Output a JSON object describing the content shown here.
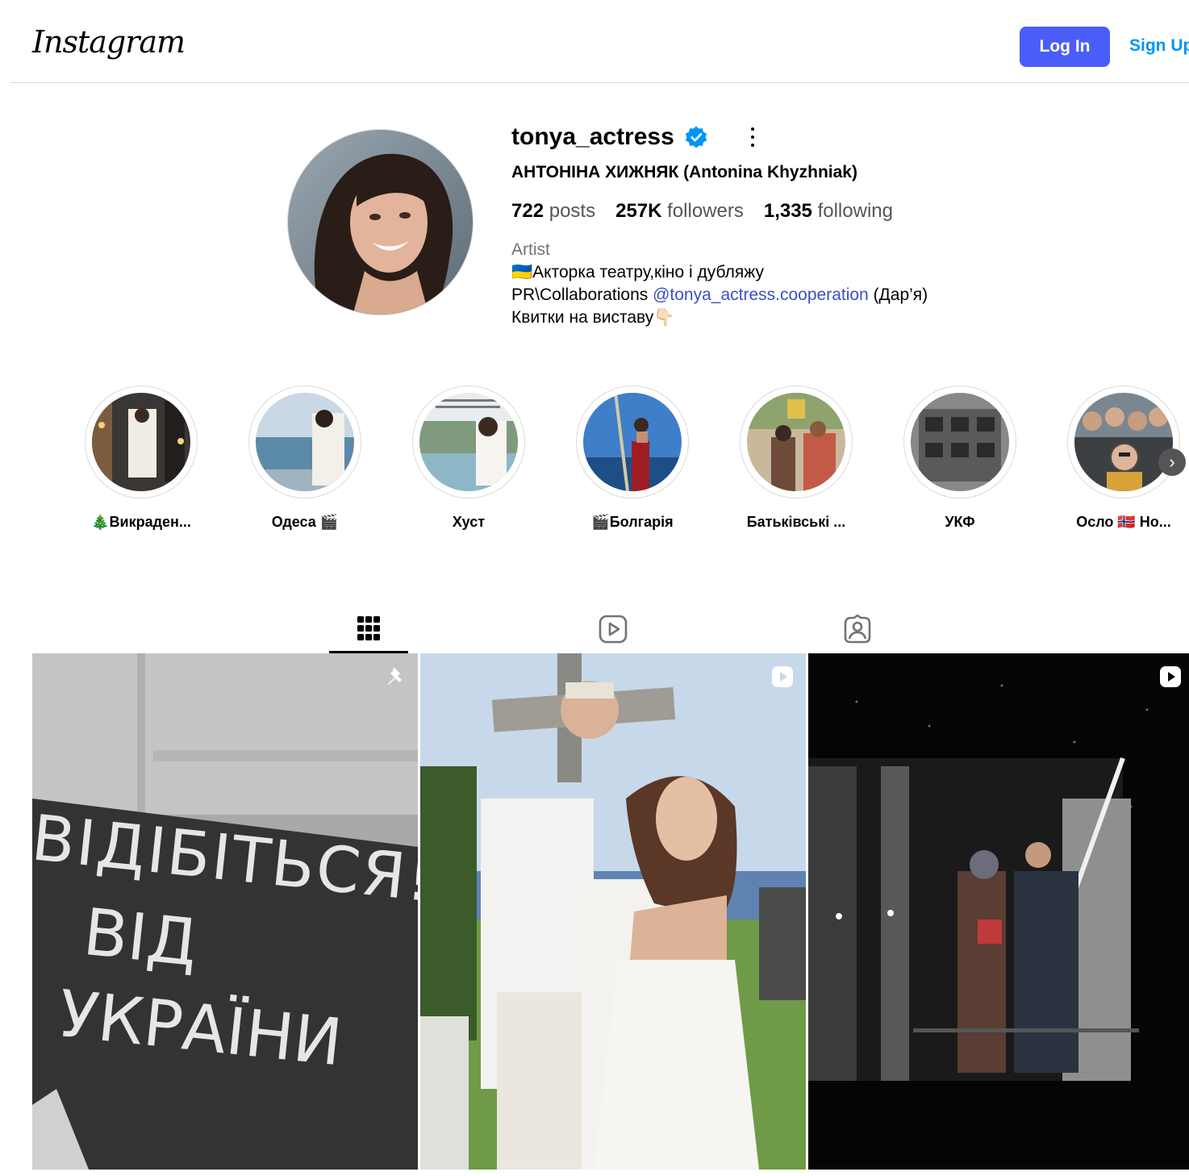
{
  "header": {
    "logo": "Instagram",
    "login_label": "Log In",
    "signup_label": "Sign Up"
  },
  "profile": {
    "username": "tonya_actress",
    "full_name": "АНТОНІНА ХИЖНЯК (Antonina Khyzhniak)",
    "stats": {
      "posts_count": "722",
      "posts_label": "posts",
      "followers_count": "257K",
      "followers_label": "followers",
      "following_count": "1,335",
      "following_label": "following"
    },
    "bio": {
      "category": "Artist",
      "line1": "🇺🇦Акторка театру,кіно і дубляжу",
      "line2_prefix": "PR\\Collaborations ",
      "line2_mention": "@tonya_actress.cooperation",
      "line2_suffix": " (Дар’я)",
      "line3": "Квитки на виставу👇🏻"
    }
  },
  "highlights": [
    {
      "label": "🎄Викраден..."
    },
    {
      "label": "Одеса 🎬"
    },
    {
      "label": "Хуст"
    },
    {
      "label": "🎬Болгарія"
    },
    {
      "label": "Батьківські ..."
    },
    {
      "label": "УКФ"
    },
    {
      "label": "Осло 🇳🇴 Но..."
    }
  ],
  "tabs": [
    {
      "name": "posts-tab",
      "icon": "grid-icon",
      "active": true
    },
    {
      "name": "reels-tab",
      "icon": "reels-icon",
      "active": false
    },
    {
      "name": "tagged-tab",
      "icon": "tagged-icon",
      "active": false
    }
  ],
  "posts": [
    {
      "badge": "pin-icon",
      "sign_text": [
        "ВІДІБІТЬСЯ!",
        "ВІД",
        "УКРАЇНИ"
      ]
    },
    {
      "badge": "reel-icon"
    },
    {
      "badge": "reel-icon"
    }
  ],
  "colors": {
    "login_button": "#4a5df9",
    "signup_link": "#0095f6",
    "verified_badge": "#0095f6",
    "mention": "#3b4fc4"
  }
}
